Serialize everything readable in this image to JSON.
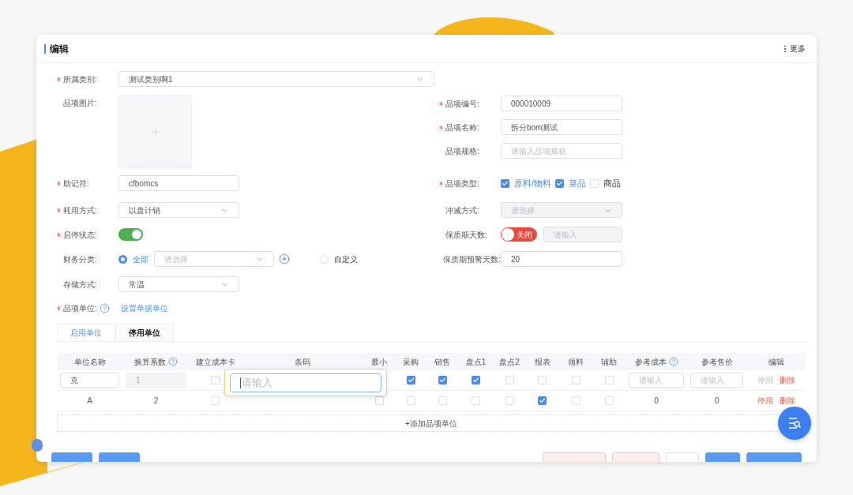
{
  "header": {
    "title": "编辑",
    "more": "更多"
  },
  "form": {
    "category": {
      "label": "所属类别:",
      "required": true,
      "value": "测试类别啊1"
    },
    "image": {
      "label": "品项图片:",
      "required": false
    },
    "code": {
      "label": "品项编号:",
      "required": true,
      "value": "000010009"
    },
    "name": {
      "label": "品项名称:",
      "required": true,
      "value": "拆分bom测试"
    },
    "spec": {
      "label": "品项规格:",
      "required": false,
      "placeholder": "请输入品项规格"
    },
    "mnemonic": {
      "label": "助记符:",
      "required": true,
      "value": "cfbomcs"
    },
    "item_type": {
      "label": "品项类型:",
      "required": true,
      "options": [
        {
          "label": "原料/物料",
          "checked": true
        },
        {
          "label": "菜品",
          "checked": true
        },
        {
          "label": "商品",
          "checked": false
        }
      ]
    },
    "consumption": {
      "label": "耗用方式:",
      "required": true,
      "value": "以盘计销"
    },
    "offset": {
      "label": "冲减方式:",
      "required": false,
      "placeholder": "请选择",
      "disabled": true
    },
    "status": {
      "label": "启停状态:",
      "required": true,
      "on": true
    },
    "shelf_life": {
      "label": "保质期天数:",
      "required": false,
      "on": false,
      "toggle_text": "关闭",
      "placeholder": "请输入"
    },
    "finance": {
      "label": "财务分类:",
      "required": false,
      "options": [
        {
          "label": "全部",
          "selected": true
        },
        {
          "label": "自定义",
          "selected": false
        }
      ],
      "placeholder": "请选择"
    },
    "warning_days": {
      "label": "保质期预警天数:",
      "required": false,
      "value": "20"
    },
    "storage": {
      "label": "存储方式:",
      "required": false,
      "value": "常温"
    },
    "unit": {
      "label": "品项单位:",
      "required": true,
      "link": "设置单据单位"
    }
  },
  "tabs": [
    {
      "label": "启用单位",
      "selected": true
    },
    {
      "label": "停用单位",
      "selected": false
    }
  ],
  "table": {
    "columns": [
      {
        "label": "单位名称",
        "help": false
      },
      {
        "label": "换算系数",
        "help": true
      },
      {
        "label": "建立成本卡",
        "help": false
      },
      {
        "label": "条码",
        "help": false
      },
      {
        "label": "最小",
        "help": false
      },
      {
        "label": "采购",
        "help": false
      },
      {
        "label": "销售",
        "help": false
      },
      {
        "label": "盘点1",
        "help": false
      },
      {
        "label": "盘点2",
        "help": false
      },
      {
        "label": "报表",
        "help": false
      },
      {
        "label": "领料",
        "help": false
      },
      {
        "label": "辅助",
        "help": false
      },
      {
        "label": "参考成本",
        "help": true
      },
      {
        "label": "参考售价",
        "help": false
      },
      {
        "label": "编辑",
        "help": false
      }
    ],
    "rows": [
      {
        "cells": [
          {
            "kind": "input",
            "value": "克",
            "disabled": false
          },
          {
            "kind": "input",
            "value": "1",
            "disabled": true
          },
          {
            "kind": "checkbox",
            "checked": false
          },
          {
            "kind": "blank"
          },
          {
            "kind": "blank"
          },
          {
            "kind": "checkbox",
            "checked": true
          },
          {
            "kind": "checkbox",
            "checked": true
          },
          {
            "kind": "checkbox",
            "checked": true
          },
          {
            "kind": "checkbox",
            "checked": false
          },
          {
            "kind": "checkbox",
            "checked": false
          },
          {
            "kind": "checkbox",
            "checked": false
          },
          {
            "kind": "checkbox",
            "checked": false
          },
          {
            "kind": "input",
            "placeholder": "请输入",
            "disabled": false
          },
          {
            "kind": "input",
            "placeholder": "请输入",
            "disabled": false
          },
          {
            "kind": "actions",
            "items": [
              {
                "label": "停用",
                "disabled": true
              },
              {
                "label": "删除",
                "disabled": false
              }
            ]
          }
        ]
      },
      {
        "cells": [
          {
            "kind": "text",
            "value": "A"
          },
          {
            "kind": "text",
            "value": "2"
          },
          {
            "kind": "checkbox",
            "checked": false
          },
          {
            "kind": "blank"
          },
          {
            "kind": "checkbox",
            "checked": false
          },
          {
            "kind": "checkbox",
            "checked": false
          },
          {
            "kind": "checkbox",
            "checked": false
          },
          {
            "kind": "checkbox",
            "checked": false
          },
          {
            "kind": "checkbox",
            "checked": false
          },
          {
            "kind": "checkbox",
            "checked": true
          },
          {
            "kind": "checkbox",
            "checked": false
          },
          {
            "kind": "checkbox",
            "checked": false
          },
          {
            "kind": "text",
            "value": "0"
          },
          {
            "kind": "text",
            "value": "0"
          },
          {
            "kind": "actions",
            "items": [
              {
                "label": "停用",
                "disabled": false
              },
              {
                "label": "删除",
                "disabled": false
              }
            ]
          }
        ]
      }
    ],
    "add_label": "+添加品项单位"
  },
  "popup": {
    "placeholder": "请输入"
  },
  "footer": [
    {
      "kind": "primary"
    },
    {
      "kind": "primary"
    },
    {
      "kind": "danger"
    },
    {
      "kind": "danger"
    },
    {
      "kind": "default"
    },
    {
      "kind": "primary"
    },
    {
      "kind": "primary"
    }
  ]
}
